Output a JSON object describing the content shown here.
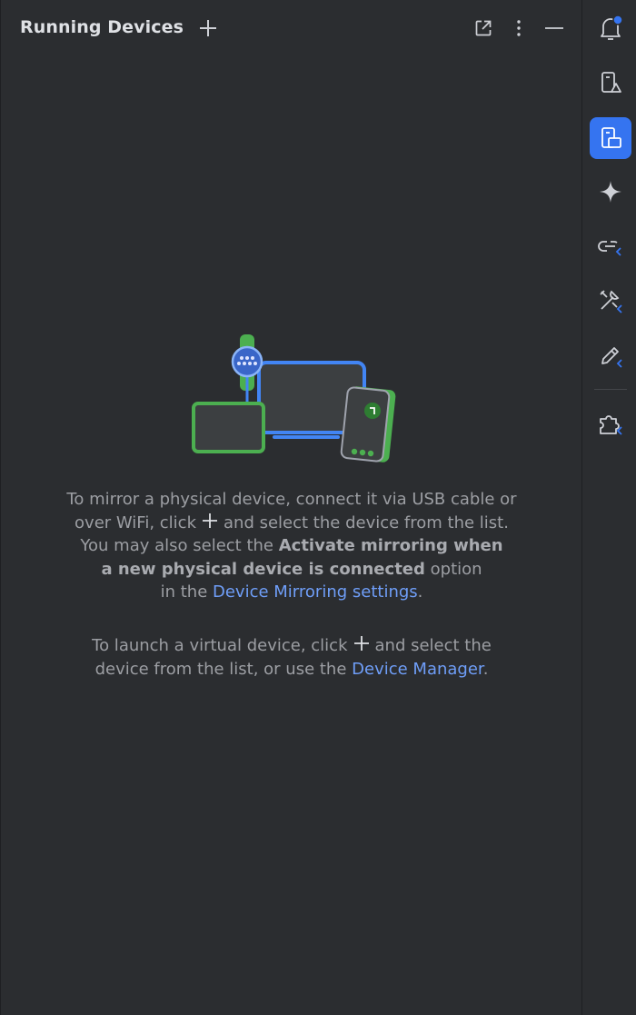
{
  "header": {
    "title": "Running Devices",
    "icons": [
      "add-icon",
      "open-in-window-icon",
      "more-options-icon",
      "minimize-icon"
    ]
  },
  "sidebar": {
    "items": [
      {
        "name": "notifications",
        "icon": "bell-icon",
        "active": false
      },
      {
        "name": "device-explorer",
        "icon": "device-explorer-icon",
        "active": false
      },
      {
        "name": "running-devices",
        "icon": "running-devices-icon",
        "active": true
      },
      {
        "name": "gemini",
        "icon": "sparkle-icon",
        "active": false
      },
      {
        "name": "app-links",
        "icon": "link-icon",
        "active": false
      },
      {
        "name": "tools",
        "icon": "tools-icon",
        "active": false
      },
      {
        "name": "edit",
        "icon": "pencil-icon",
        "active": false
      },
      {
        "name": "plugins",
        "icon": "puzzle-icon",
        "active": false
      }
    ]
  },
  "empty_state": {
    "mirror": {
      "line1": "To mirror a physical device, connect it via USB cable or",
      "line2_pre": "over WiFi, click",
      "line2_post": "and select the device from the list.",
      "line3_pre": "You may also select the",
      "bold1": "Activate mirroring when",
      "bold2": "a new physical device is connected",
      "line4_post": "option",
      "line5_pre": "in the",
      "link": "Device Mirroring settings",
      "line5_post": "."
    },
    "virtual": {
      "line1_pre": "To launch a virtual device, click",
      "line1_post": "and select the",
      "line2_pre": "device from the list, or use the",
      "link": "Device Manager",
      "line2_post": "."
    }
  },
  "colors": {
    "background": "#2b2d30",
    "accent": "#3574f0",
    "link": "#6f9ef8",
    "text_muted": "#9c9ea3",
    "device_green": "#4caf50",
    "device_blue": "#4285f4"
  }
}
